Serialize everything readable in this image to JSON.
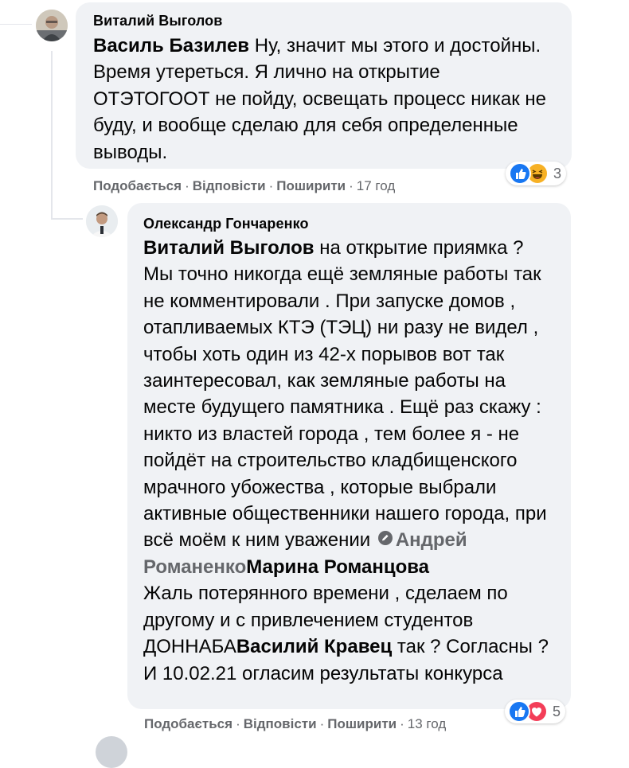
{
  "comments": [
    {
      "author": "Виталий Выголов",
      "mention": "Василь Базилев",
      "text": " Ну, значит мы этого и достойны. Время утереться. Я лично на открытие ОТЭТОГООТ не пойду, освещать процесс никак не буду, и вообще сделаю для себя определенные выводы.",
      "actions": {
        "like": "Подобається",
        "reply": "Відповісти",
        "share": "Поширити",
        "time": "17 год"
      },
      "reactions": {
        "icons": [
          "like-icon",
          "haha-icon"
        ],
        "count": "3"
      }
    },
    {
      "author": "Олександр Гончаренко",
      "mention1": "Виталий Выголов",
      "text1": " на открытие приямка ? Мы точно никогда ещё земляные работы так не комментировали . При запуске домов , отапливаемых КТЭ (ТЭЦ) ни разу не видел , чтобы хоть один из 42-х порывов вот так заинтересовал, как земляные работы на месте будущего памятника . Ещё раз скажу : никто из властей города , тем более я - не пойдёт на строительство кладбищенского мрачного убожества , которые выбрали активные общественники нашего города, при всё моём к ним уважении ",
      "mention2": "Андрей Романенко",
      "mention3": "Марина Романцова",
      "text2": "Жаль потерянного времени , сделаем по другому и с привлечением студентов ДОННАБА",
      "mention4": "Василий Кравец",
      "text3": " так ? Согласны ? И 10.02.21 огласим результаты конкурса",
      "actions": {
        "like": "Подобається",
        "reply": "Відповісти",
        "share": "Поширити",
        "time": "13 год"
      },
      "reactions": {
        "icons": [
          "like-icon",
          "love-icon"
        ],
        "count": "5"
      }
    }
  ],
  "colors": {
    "bubble": "#f0f2f5",
    "like": "#1877f2",
    "love": "#f33e58",
    "haha": "#f7b125",
    "meta": "#65676b"
  }
}
